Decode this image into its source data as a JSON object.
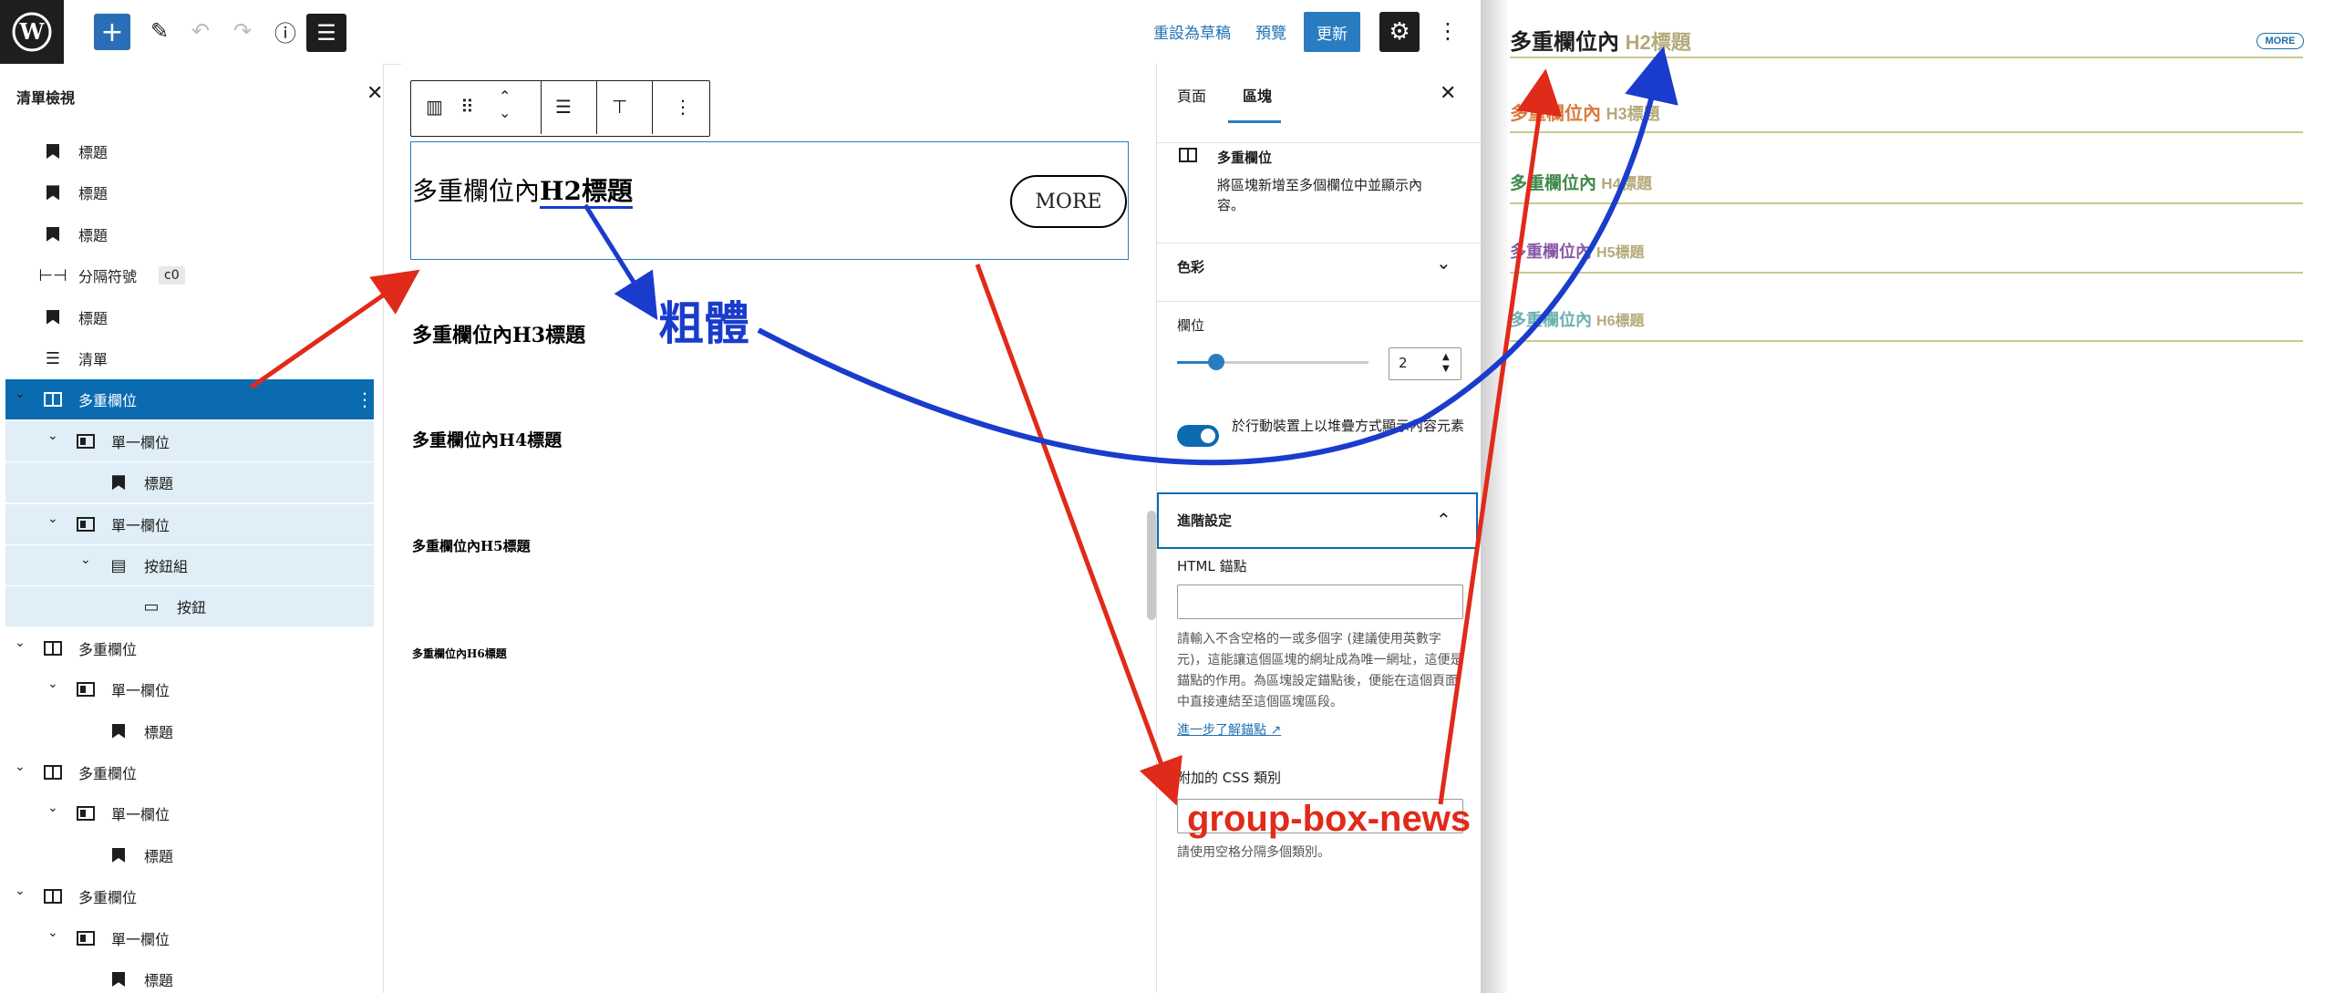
{
  "topbar": {
    "revert_label": "重設為草稿",
    "preview_label": "預覽",
    "update_label": "更新"
  },
  "listview": {
    "title": "清單檢視",
    "items": [
      {
        "label": "標題",
        "icon": "bookmark-icon"
      },
      {
        "label": "標題",
        "icon": "bookmark-icon"
      },
      {
        "label": "標題",
        "icon": "bookmark-icon"
      },
      {
        "label": "分隔符號",
        "icon": "separator-icon",
        "badge": "c0"
      },
      {
        "label": "標題",
        "icon": "bookmark-icon"
      },
      {
        "label": "清單",
        "icon": "list-icon"
      },
      {
        "label": "多重欄位",
        "icon": "columns-icon",
        "selected": true
      },
      {
        "label": "單一欄位",
        "icon": "column-icon"
      },
      {
        "label": "標題",
        "icon": "bookmark-icon"
      },
      {
        "label": "單一欄位",
        "icon": "column-icon"
      },
      {
        "label": "按鈕組",
        "icon": "buttons-icon"
      },
      {
        "label": "按鈕",
        "icon": "button-icon"
      },
      {
        "label": "多重欄位",
        "icon": "columns-icon"
      },
      {
        "label": "單一欄位",
        "icon": "column-icon"
      },
      {
        "label": "標題",
        "icon": "bookmark-icon"
      },
      {
        "label": "多重欄位",
        "icon": "columns-icon"
      },
      {
        "label": "單一欄位",
        "icon": "column-icon"
      },
      {
        "label": "標題",
        "icon": "bookmark-icon"
      },
      {
        "label": "多重欄位",
        "icon": "columns-icon"
      },
      {
        "label": "單一欄位",
        "icon": "column-icon"
      },
      {
        "label": "標題",
        "icon": "bookmark-icon"
      }
    ]
  },
  "canvas": {
    "h2_prefix": "多重欄位內",
    "h2_bold": "H2標題",
    "more_label": "MORE",
    "h3": "多重欄位內H3標題",
    "h4": "多重欄位內H4標題",
    "h5": "多重欄位內H5標題",
    "h6": "多重欄位內H6標題"
  },
  "inspector": {
    "tab_page": "頁面",
    "tab_block": "區塊",
    "block_name": "多重欄位",
    "block_desc": "將區塊新增至多個欄位中並顯示內容。",
    "color_section": "色彩",
    "columns_label": "欄位",
    "columns_value": "2",
    "stack_label": "於行動裝置上以堆疊方式顯示內容元素",
    "advanced_label": "進階設定",
    "anchor_label": "HTML 錨點",
    "anchor_help": "請輸入不含空格的一或多個字 (建議使用英數字元)，這能讓這個區塊的網址成為唯一網址，這便是錨點的作用。為區塊設定錨點後，便能在這個頁面中直接連結至這個區塊區段。",
    "anchor_link": "進一步了解錨點",
    "css_label": "附加的 CSS 類別",
    "css_help": "請使用空格分隔多個類別。"
  },
  "preview": {
    "headings": [
      {
        "prefix": "多重欄位內",
        "suffix": "H2標題",
        "color": "#1e1e1e"
      },
      {
        "prefix": "多重欄位內",
        "suffix": "H3標題",
        "color": "#d97a3a"
      },
      {
        "prefix": "多重欄位內",
        "suffix": "H4標題",
        "color": "#3f8a4a"
      },
      {
        "prefix": "多重欄位內",
        "suffix": "H5標題",
        "color": "#8a5aa8"
      },
      {
        "prefix": "多重欄位內",
        "suffix": "H6標題",
        "color": "#6fb0b0"
      }
    ],
    "more_label": "MORE"
  },
  "annotations": {
    "bold_label": "粗體",
    "css_class": "group-box-news"
  },
  "colors": {
    "accent": "#2271b1",
    "selected": "#0a6bb1",
    "annotation_red": "#e02a1a",
    "annotation_blue": "#1a3ccc"
  }
}
